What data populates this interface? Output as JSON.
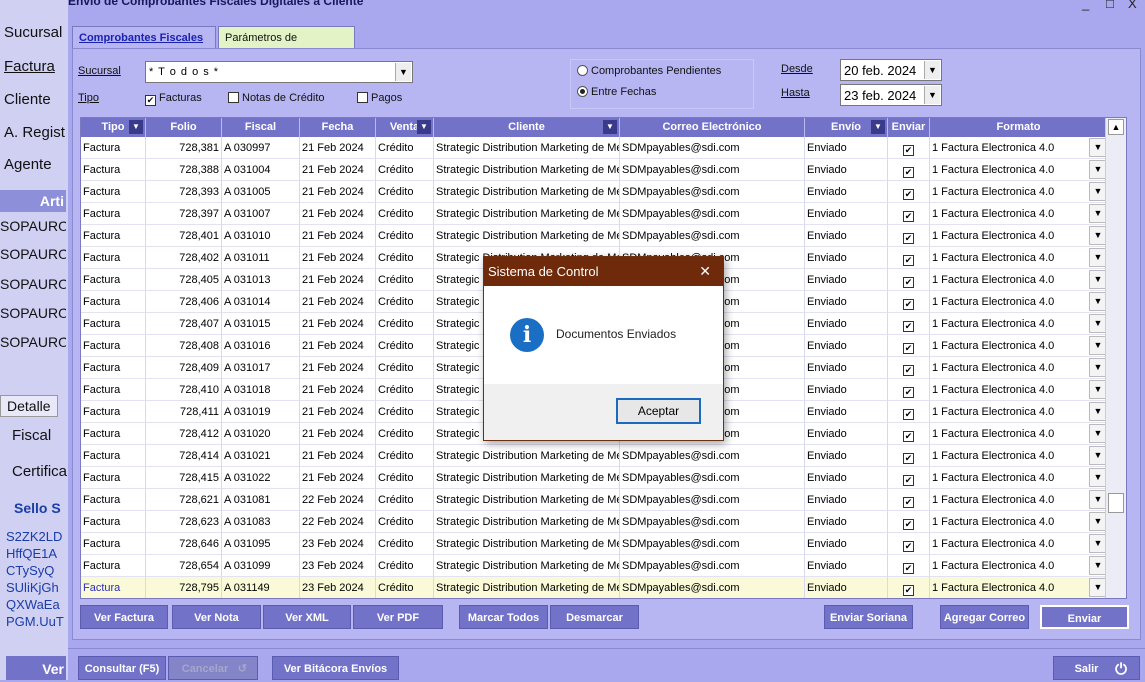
{
  "background_app": {
    "menu": [
      "Sucursal",
      "Factura",
      "Cliente",
      "A. Regist",
      "Agente"
    ],
    "section_title": "Arti",
    "codes": [
      "SOPAURO",
      "SOPAURO",
      "SOPAURO",
      "SOPAURO",
      "SOPAURO"
    ],
    "detail_tab": "Detalle",
    "detail_items": [
      "Fiscal",
      "Certifica"
    ],
    "sello_title": "Sello S",
    "sello_lines": [
      "S2ZK2LD",
      "HffQE1A",
      "CTySyQ",
      "SUliKjGh",
      "QXWaEa",
      "PGM.UuT"
    ],
    "bottom_button": "Ver"
  },
  "window": {
    "title": "Envío de Comprobantes Fiscales Digitales a Cliente",
    "controls": [
      "_",
      "□",
      "X"
    ]
  },
  "tabs": [
    {
      "label": "Comprobantes Fiscales",
      "active": true
    },
    {
      "label": "Parámetros de Operación",
      "active": false
    }
  ],
  "filters": {
    "sucursal_label": "Sucursal",
    "sucursal_value": "* T o d o s *",
    "tipo_label": "Tipo",
    "tipo_options": [
      {
        "label": "Facturas",
        "checked": true
      },
      {
        "label": "Notas de Crédito",
        "checked": false
      },
      {
        "label": "Pagos",
        "checked": false
      }
    ],
    "mode_options": [
      {
        "label": "Comprobantes Pendientes",
        "selected": false
      },
      {
        "label": "Entre Fechas",
        "selected": true
      }
    ],
    "desde_label": "Desde",
    "desde_value": "20  feb.  2024",
    "hasta_label": "Hasta",
    "hasta_value": "23  feb.  2024"
  },
  "grid": {
    "columns": [
      "Tipo",
      "Folio",
      "Fiscal",
      "Fecha",
      "Venta",
      "Cliente",
      "Correo Electrónico",
      "Envío",
      "Enviar",
      "Formato"
    ],
    "rows": [
      [
        "Factura",
        "728,381",
        "A 030997",
        "21 Feb 2024",
        "Crédito",
        "Strategic Distribution Marketing de Mex",
        "SDMpayables@sdi.com",
        "Enviado",
        "1 Factura Electronica 4.0"
      ],
      [
        "Factura",
        "728,388",
        "A 031004",
        "21 Feb 2024",
        "Crédito",
        "Strategic Distribution Marketing de Mex",
        "SDMpayables@sdi.com",
        "Enviado",
        "1 Factura Electronica 4.0"
      ],
      [
        "Factura",
        "728,393",
        "A 031005",
        "21 Feb 2024",
        "Crédito",
        "Strategic Distribution Marketing de Mex",
        "SDMpayables@sdi.com",
        "Enviado",
        "1 Factura Electronica 4.0"
      ],
      [
        "Factura",
        "728,397",
        "A 031007",
        "21 Feb 2024",
        "Crédito",
        "Strategic Distribution Marketing de Mex",
        "SDMpayables@sdi.com",
        "Enviado",
        "1 Factura Electronica 4.0"
      ],
      [
        "Factura",
        "728,401",
        "A 031010",
        "21 Feb 2024",
        "Crédito",
        "Strategic Distribution Marketing de Mex",
        "SDMpayables@sdi.com",
        "Enviado",
        "1 Factura Electronica 4.0"
      ],
      [
        "Factura",
        "728,402",
        "A 031011",
        "21 Feb 2024",
        "Crédito",
        "Strategic Distribution Marketing de Mex",
        "SDMpayables@sdi.com",
        "Enviado",
        "1 Factura Electronica 4.0"
      ],
      [
        "Factura",
        "728,405",
        "A 031013",
        "21 Feb 2024",
        "Crédito",
        "Strategic Distribution Marketing de Mex",
        "SDMpayables@sdi.com",
        "Enviado",
        "1 Factura Electronica 4.0"
      ],
      [
        "Factura",
        "728,406",
        "A 031014",
        "21 Feb 2024",
        "Crédito",
        "Strategic Distribution Marketing de Mex",
        "SDMpayables@sdi.com",
        "Enviado",
        "1 Factura Electronica 4.0"
      ],
      [
        "Factura",
        "728,407",
        "A 031015",
        "21 Feb 2024",
        "Crédito",
        "Strategic Distribution Marketing de Mex",
        "SDMpayables@sdi.com",
        "Enviado",
        "1 Factura Electronica 4.0"
      ],
      [
        "Factura",
        "728,408",
        "A 031016",
        "21 Feb 2024",
        "Crédito",
        "Strategic Distribution Marketing de Mex",
        "SDMpayables@sdi.com",
        "Enviado",
        "1 Factura Electronica 4.0"
      ],
      [
        "Factura",
        "728,409",
        "A 031017",
        "21 Feb 2024",
        "Crédito",
        "Strategic Distribution Marketing de Mex",
        "SDMpayables@sdi.com",
        "Enviado",
        "1 Factura Electronica 4.0"
      ],
      [
        "Factura",
        "728,410",
        "A 031018",
        "21 Feb 2024",
        "Crédito",
        "Strategic Distribution Marketing de Mex",
        "SDMpayables@sdi.com",
        "Enviado",
        "1 Factura Electronica 4.0"
      ],
      [
        "Factura",
        "728,411",
        "A 031019",
        "21 Feb 2024",
        "Crédito",
        "Strategic Distribution Marketing de Mex",
        "SDMpayables@sdi.com",
        "Enviado",
        "1 Factura Electronica 4.0"
      ],
      [
        "Factura",
        "728,412",
        "A 031020",
        "21 Feb 2024",
        "Crédito",
        "Strategic Distribution Marketing de Mex",
        "SDMpayables@sdi.com",
        "Enviado",
        "1 Factura Electronica 4.0"
      ],
      [
        "Factura",
        "728,414",
        "A 031021",
        "21 Feb 2024",
        "Crédito",
        "Strategic Distribution Marketing de Mex",
        "SDMpayables@sdi.com",
        "Enviado",
        "1 Factura Electronica 4.0"
      ],
      [
        "Factura",
        "728,415",
        "A 031022",
        "21 Feb 2024",
        "Crédito",
        "Strategic Distribution Marketing de Mex",
        "SDMpayables@sdi.com",
        "Enviado",
        "1 Factura Electronica 4.0"
      ],
      [
        "Factura",
        "728,621",
        "A 031081",
        "22 Feb 2024",
        "Crédito",
        "Strategic Distribution Marketing de Mex",
        "SDMpayables@sdi.com",
        "Enviado",
        "1 Factura Electronica 4.0"
      ],
      [
        "Factura",
        "728,623",
        "A 031083",
        "22 Feb 2024",
        "Crédito",
        "Strategic Distribution Marketing de Mex",
        "SDMpayables@sdi.com",
        "Enviado",
        "1 Factura Electronica 4.0"
      ],
      [
        "Factura",
        "728,646",
        "A 031095",
        "23 Feb 2024",
        "Crédito",
        "Strategic Distribution Marketing de Mex",
        "SDMpayables@sdi.com",
        "Enviado",
        "1 Factura Electronica 4.0"
      ],
      [
        "Factura",
        "728,654",
        "A 031099",
        "23 Feb 2024",
        "Crédito",
        "Strategic Distribution Marketing de Mex",
        "SDMpayables@sdi.com",
        "Enviado",
        "1 Factura Electronica 4.0"
      ],
      [
        "Factura",
        "728,795",
        "A 031149",
        "23 Feb 2024",
        "Crédito",
        "Strategic Distribution Marketing de Mex",
        "SDMpayables@sdi.com",
        "Enviado",
        "1 Factura Electronica 4.0"
      ]
    ],
    "highlighted_row": 20
  },
  "buttons": {
    "ver_factura": "Ver Factura",
    "ver_nota": "Ver Nota",
    "ver_xml": "Ver XML",
    "ver_pdf": "Ver PDF",
    "marcar_todos": "Marcar Todos",
    "desmarcar": "Desmarcar",
    "enviar_soriana": "Enviar Soriana",
    "agregar_correo": "Agregar Correo",
    "enviar": "Enviar",
    "consultar": "Consultar (F5)",
    "cancelar": "Cancelar",
    "ver_bitacora": "Ver Bitácora Envíos",
    "salir": "Salir"
  },
  "dialog": {
    "title": "Sistema de Control",
    "message": "Documentos Enviados",
    "ok_label": "Aceptar",
    "icon": "info-icon",
    "close": "✕"
  }
}
